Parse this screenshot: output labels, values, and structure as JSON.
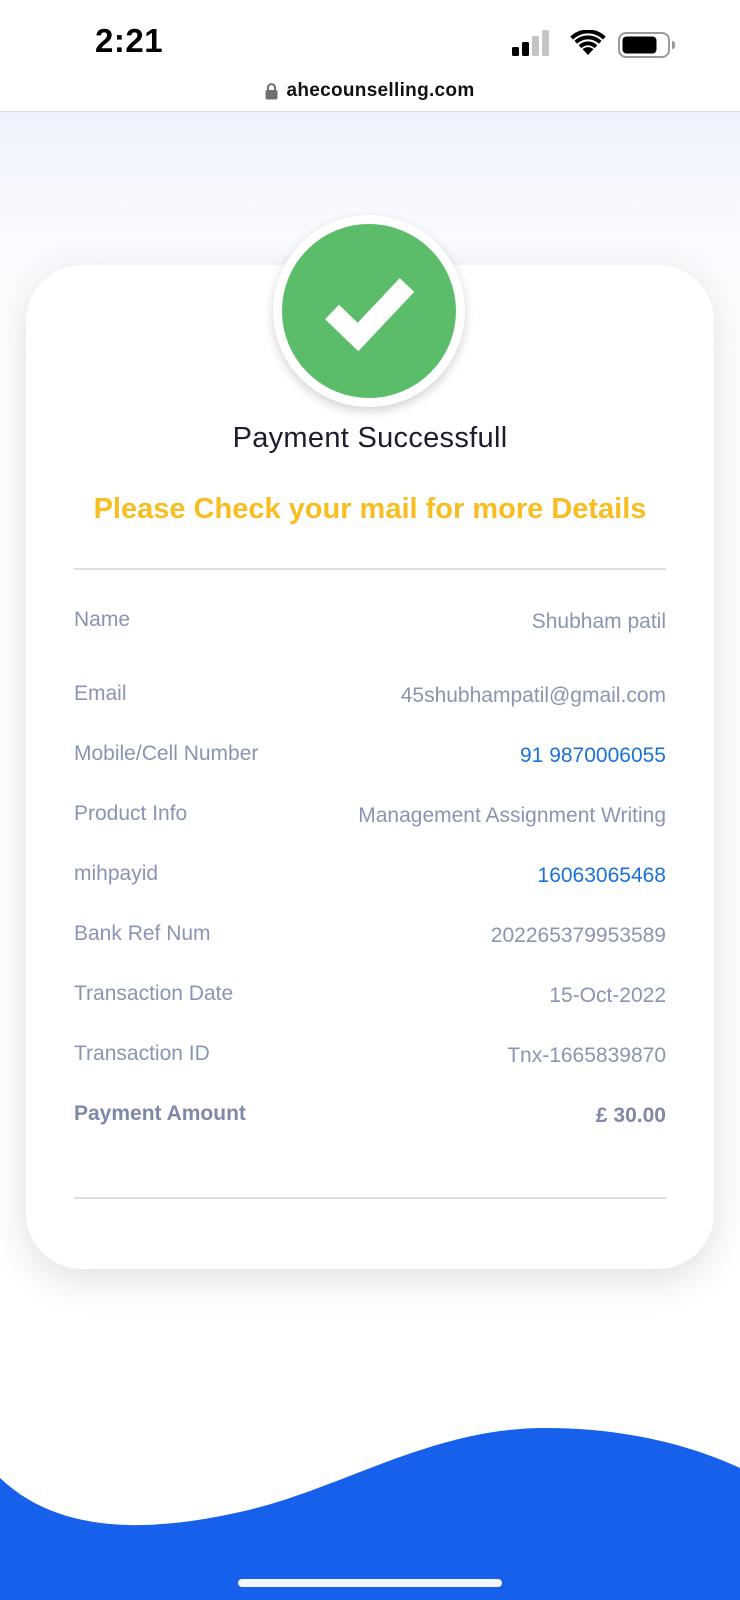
{
  "status_bar": {
    "time": "2:21"
  },
  "browser": {
    "url": "ahecounselling.com"
  },
  "payment": {
    "title": "Payment Successfull",
    "subtitle": "Please Check your mail for more Details",
    "details": [
      {
        "label": "Name",
        "value": "Shubham patil"
      },
      {
        "label": "Email",
        "value": "45shubhampatil@gmail.com"
      },
      {
        "label": "Mobile/Cell Number",
        "value": "91 9870006055"
      },
      {
        "label": "Product Info",
        "value": "Management Assignment Writing"
      },
      {
        "label": "mihpayid",
        "value": "16063065468"
      },
      {
        "label": "Bank Ref Num",
        "value": "202265379953589"
      },
      {
        "label": "Transaction Date",
        "value": "15-Oct-2022"
      },
      {
        "label": "Transaction ID",
        "value": "Tnx-1665839870"
      },
      {
        "label": "Payment Amount",
        "value": "£ 30.00"
      }
    ]
  },
  "colors": {
    "success_green": "#5bbd6a",
    "highlight_yellow": "#f7bd21",
    "link_blue": "#1a72d8",
    "wave_blue": "#1760ec",
    "muted_text": "#8a94b4"
  },
  "icons": {
    "success": "check-icon",
    "lock": "lock-icon",
    "signal": "signal-icon",
    "wifi": "wifi-icon",
    "battery": "battery-icon"
  }
}
